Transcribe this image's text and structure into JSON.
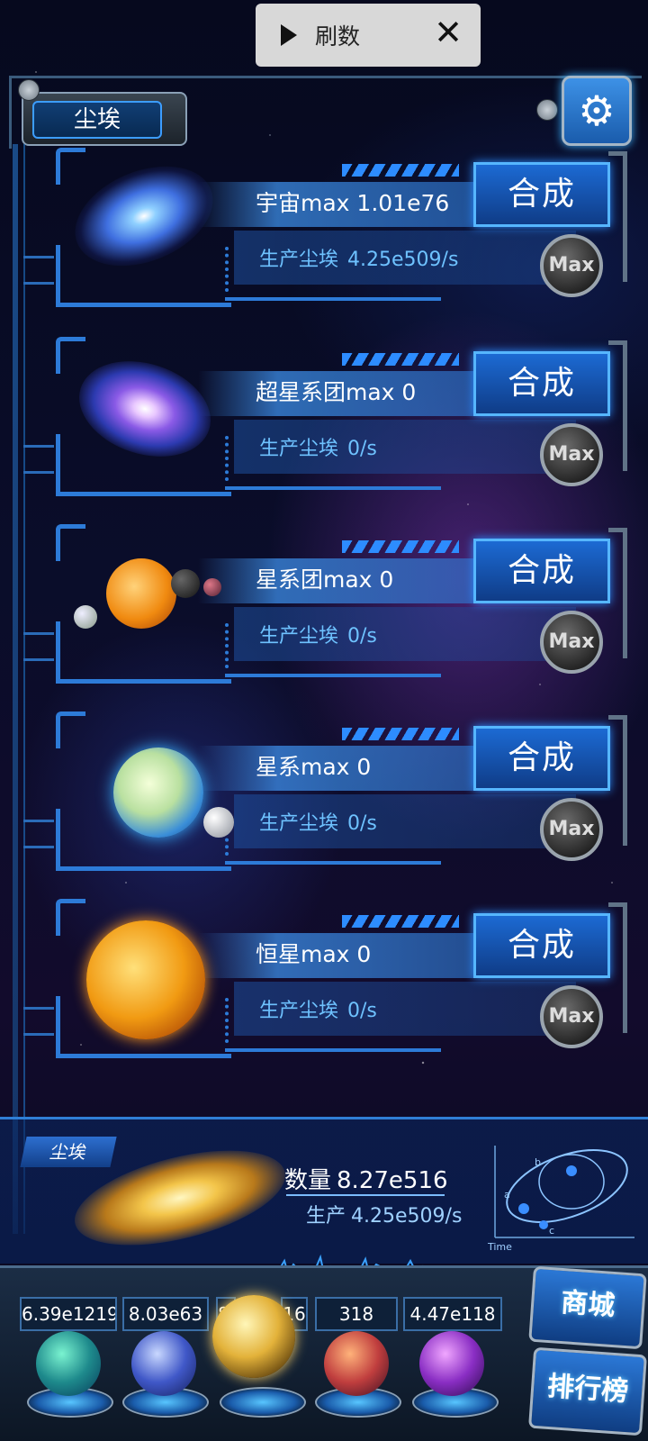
{
  "toast": {
    "label": "刷数",
    "close": "✕"
  },
  "header": {
    "title": "尘埃",
    "settings_icon": "gear-icon"
  },
  "rows": [
    {
      "id": "universe",
      "name": "宇宙max 1.01e76",
      "prod_label": "生产尘埃",
      "prod_value": "4.25e509/s",
      "synth": "合成",
      "max": "Max"
    },
    {
      "id": "supercluster",
      "name": "超星系团max 0",
      "prod_label": "生产尘埃",
      "prod_value": "0/s",
      "synth": "合成",
      "max": "Max"
    },
    {
      "id": "cluster",
      "name": "星系团max 0",
      "prod_label": "生产尘埃",
      "prod_value": "0/s",
      "synth": "合成",
      "max": "Max"
    },
    {
      "id": "galaxy",
      "name": "星系max 0",
      "prod_label": "生产尘埃",
      "prod_value": "0/s",
      "synth": "合成",
      "max": "Max"
    },
    {
      "id": "star",
      "name": "恒星max 0",
      "prod_label": "生产尘埃",
      "prod_value": "0/s",
      "synth": "合成",
      "max": "Max"
    }
  ],
  "dust": {
    "tab": "尘埃",
    "qty_label": "数量",
    "qty_value": "8.27e516",
    "rate_label": "生产",
    "rate_value": "4.25e509/s",
    "diagram_axis": "Time",
    "diagram_labels": [
      "a",
      "b",
      "c"
    ]
  },
  "bottom": {
    "counters": [
      "6.39e1219",
      "8.03e63",
      "8.",
      "16",
      "318",
      "4.47e118"
    ],
    "shop": "商城",
    "rank": "排行榜"
  }
}
